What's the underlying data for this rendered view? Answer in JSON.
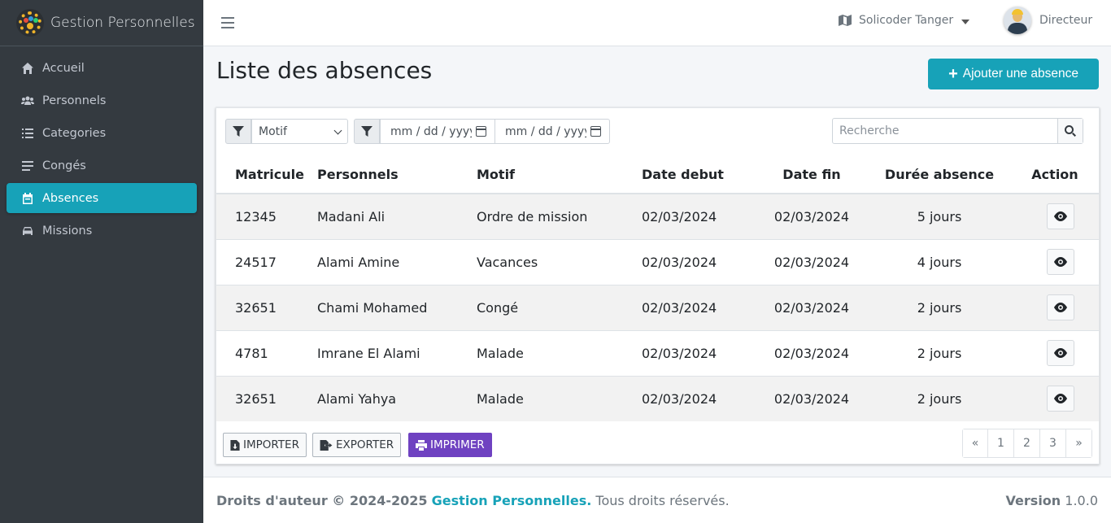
{
  "app": {
    "title": "Gestion Personnelles"
  },
  "sidebar": {
    "items": [
      {
        "label": "Accueil",
        "icon": "home-icon",
        "active": false
      },
      {
        "label": "Personnels",
        "icon": "users-icon",
        "active": false
      },
      {
        "label": "Categories",
        "icon": "list-icon",
        "active": false
      },
      {
        "label": "Congés",
        "icon": "bars-icon",
        "active": false
      },
      {
        "label": "Absences",
        "icon": "calendar-icon",
        "active": true
      },
      {
        "label": "Missions",
        "icon": "car-icon",
        "active": false
      }
    ]
  },
  "header": {
    "company": "Solicoder Tanger",
    "user_role": "Directeur"
  },
  "page": {
    "title": "Liste des absences",
    "add_button": "Ajouter une absence"
  },
  "filters": {
    "motif_select": "Motif",
    "date_from_placeholder": "mm / dd / yyyy",
    "date_to_placeholder": "mm / dd / yyyy",
    "search_placeholder": "Recherche"
  },
  "table": {
    "headers": [
      "Matricule",
      "Personnels",
      "Motif",
      "Date debut",
      "Date fin",
      "Durée absence",
      "Action"
    ],
    "rows": [
      [
        "12345",
        "Madani Ali",
        "Ordre de mission",
        "02/03/2024",
        "02/03/2024",
        "5 jours"
      ],
      [
        "24517",
        "Alami Amine",
        "Vacances",
        "02/03/2024",
        "02/03/2024",
        "4 jours"
      ],
      [
        "32651",
        "Chami Mohamed",
        "Congé",
        "02/03/2024",
        "02/03/2024",
        "2 jours"
      ],
      [
        "4781",
        "Imrane El Alami",
        "Malade",
        "02/03/2024",
        "02/03/2024",
        "2 jours"
      ],
      [
        "32651",
        "Alami Yahya",
        "Malade",
        "02/03/2024",
        "02/03/2024",
        "2 jours"
      ]
    ]
  },
  "actions": {
    "import": "IMPORTER",
    "export": "EXPORTER",
    "print": "IMPRIMER"
  },
  "pagination": [
    "«",
    "1",
    "2",
    "3",
    "»"
  ],
  "footer": {
    "copyright": "Droits d'auteur © 2024-2025",
    "brand": "Gestion Personnelles.",
    "rights": "Tous droits réservés.",
    "version_label": "Version",
    "version": "1.0.0"
  },
  "colors": {
    "accent": "#17a2b8",
    "sidebar_bg": "#343a40",
    "print_button": "#6f42c1"
  }
}
